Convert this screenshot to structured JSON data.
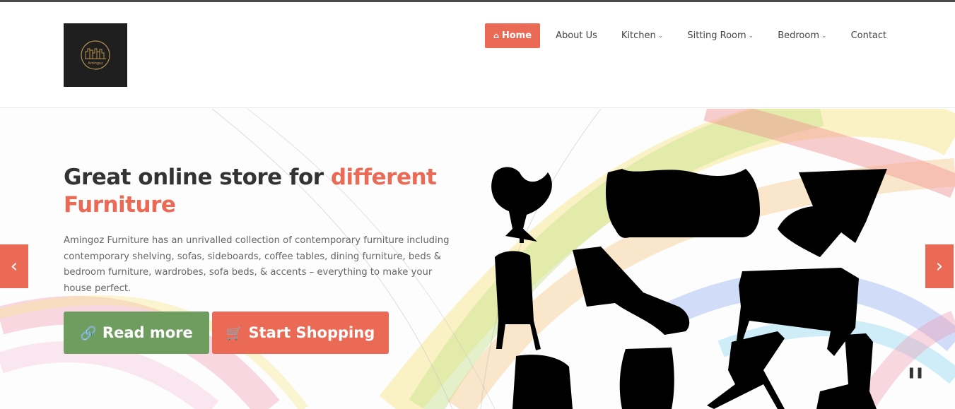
{
  "brand": {
    "logo_text": "Amingoz",
    "name": "Amingoz"
  },
  "colors": {
    "accent": "#ea6a55",
    "green": "#6f9c5f",
    "text": "#333333"
  },
  "nav": {
    "items": [
      {
        "label": "Home",
        "icon": "home-icon",
        "active": true
      },
      {
        "label": "About Us"
      },
      {
        "label": "Kitchen",
        "dropdown": true
      },
      {
        "label": "Sitting Room",
        "dropdown": true
      },
      {
        "label": "Bedroom",
        "dropdown": true
      },
      {
        "label": "Contact"
      }
    ]
  },
  "hero": {
    "headline_pre": "Great online store for ",
    "headline_accent": "different Furniture",
    "description": "Amingoz Furniture has an unrivalled collection of contemporary furniture including contemporary shelving, sofas, sideboards, coffee tables, dining furniture, beds & bedroom furniture, wardrobes, sofa beds, & accents – everything to make your house perfect.",
    "buttons": {
      "read_more": {
        "label": "Read more",
        "icon": "link-icon"
      },
      "start_shopping": {
        "label": "Start Shopping",
        "icon": "cart-icon"
      }
    },
    "controls": {
      "prev_icon": "chevron-left-icon",
      "next_icon": "chevron-right-icon",
      "pause_icon": "pause-icon"
    }
  }
}
